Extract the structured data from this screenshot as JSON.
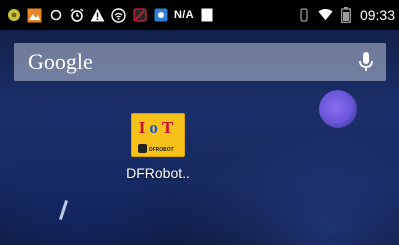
{
  "status_bar": {
    "network_label": "N/A",
    "time": "09:33",
    "left_icons": [
      "android-debug-icon",
      "image-notification-icon",
      "circle-icon",
      "alarm-icon",
      "warning-icon",
      "wifi-hotspot-icon",
      "no-sim-icon",
      "app-notification-icon",
      "sim-icon"
    ],
    "right_icons": [
      "vibrate-icon",
      "wifi-icon",
      "battery-icon"
    ]
  },
  "search": {
    "brand": "Google",
    "mic_icon": "microphone-icon"
  },
  "apps": [
    {
      "label": "DFRobot..",
      "icon_letters": [
        "I",
        "o",
        "T"
      ],
      "icon_brand": "DFROBOT",
      "icon_bg": "#f6c118"
    }
  ],
  "colors": {
    "status_bar_bg": "#000000",
    "wallpaper": "#1b2f6b",
    "orb": "#7a62e8"
  }
}
